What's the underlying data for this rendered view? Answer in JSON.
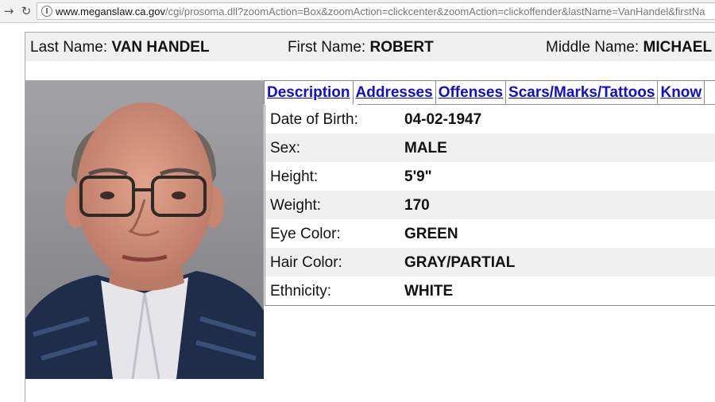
{
  "browser": {
    "url_host": "www.meganslaw.ca.gov",
    "url_path": "/cgi/prosoma.dll?zoomAction=Box&zoomAction=clickcenter&zoomAction=clickoffender&lastName=VanHandel&firstNa"
  },
  "name_bar": {
    "last_label": "Last Name:",
    "last_value": "VAN HANDEL",
    "first_label": "First Name:",
    "first_value": "ROBERT",
    "middle_label": "Middle Name:",
    "middle_value": "MICHAEL"
  },
  "tabs": [
    {
      "label": "Description"
    },
    {
      "label": "Addresses"
    },
    {
      "label": "Offenses"
    },
    {
      "label": "Scars/Marks/Tattoos"
    },
    {
      "label": "Know"
    }
  ],
  "details": [
    {
      "label": "Date of Birth:",
      "value": "04-02-1947"
    },
    {
      "label": "Sex:",
      "value": "MALE"
    },
    {
      "label": "Height:",
      "value": "5'9\""
    },
    {
      "label": "Weight:",
      "value": "170"
    },
    {
      "label": "Eye Color:",
      "value": "GREEN"
    },
    {
      "label": "Hair Color:",
      "value": "GRAY/PARTIAL"
    },
    {
      "label": "Ethnicity:",
      "value": "WHITE"
    }
  ],
  "icons": {
    "back": "back-arrow-icon",
    "reload": "reload-icon",
    "page": "page-info-icon"
  }
}
